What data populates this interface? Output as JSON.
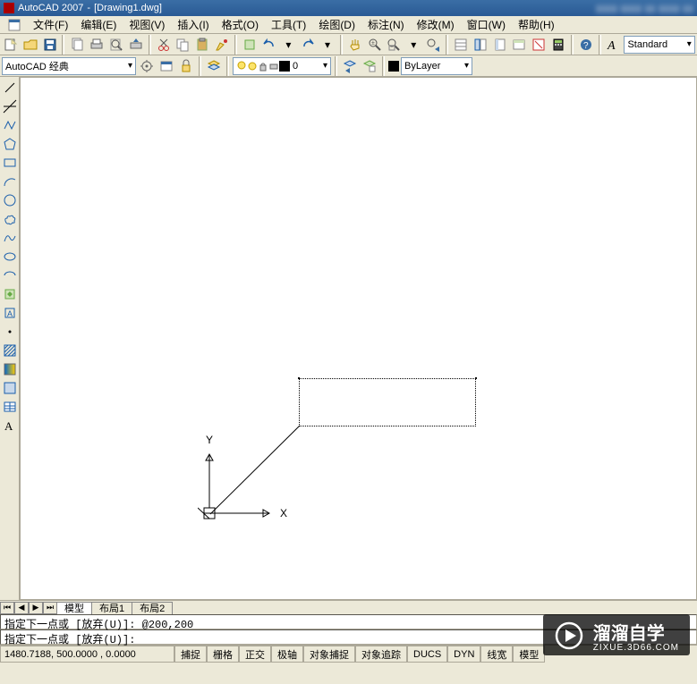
{
  "title": {
    "app": "AutoCAD 2007",
    "doc": "[Drawing1.dwg]"
  },
  "menu": {
    "file": "文件(F)",
    "edit": "编辑(E)",
    "view": "视图(V)",
    "insert": "插入(I)",
    "format": "格式(O)",
    "tools": "工具(T)",
    "draw": "绘图(D)",
    "dimension": "标注(N)",
    "modify": "修改(M)",
    "window": "窗口(W)",
    "help": "帮助(H)"
  },
  "workspace": "AutoCAD 经典",
  "layer": {
    "current": "0"
  },
  "textstyle": "Standard",
  "linestyle": "ByLayer",
  "tabs": {
    "model": "模型",
    "layout1": "布局1",
    "layout2": "布局2"
  },
  "cmd": {
    "line1_pre": "指定下一点或 [放弃(U)]: ",
    "line1_val": "@200,200",
    "line2": "指定下一点或 [放弃(U)]:"
  },
  "status": {
    "coords": "1480.7188,  500.0000 ,  0.0000",
    "snap": "捕捉",
    "grid": "栅格",
    "ortho": "正交",
    "polar": "极轴",
    "osnap": "对象捕捉",
    "otrack": "对象追踪",
    "ducs": "DUCS",
    "dyn": "DYN",
    "lwt": "线宽",
    "model": "模型"
  },
  "ucs": {
    "x": "X",
    "y": "Y"
  },
  "watermark": {
    "brand": "溜溜自学",
    "url": "ZIXUE.3D66.COM"
  },
  "icons": {
    "new": "new",
    "open": "open",
    "save": "save",
    "cut": "cut",
    "copy": "copy",
    "paste": "paste",
    "match": "match",
    "undo": "undo",
    "redo": "redo",
    "pan": "pan",
    "zoomrt": "zoomrt",
    "zoomwin": "zoomwin",
    "zoomprev": "zoomprev"
  }
}
